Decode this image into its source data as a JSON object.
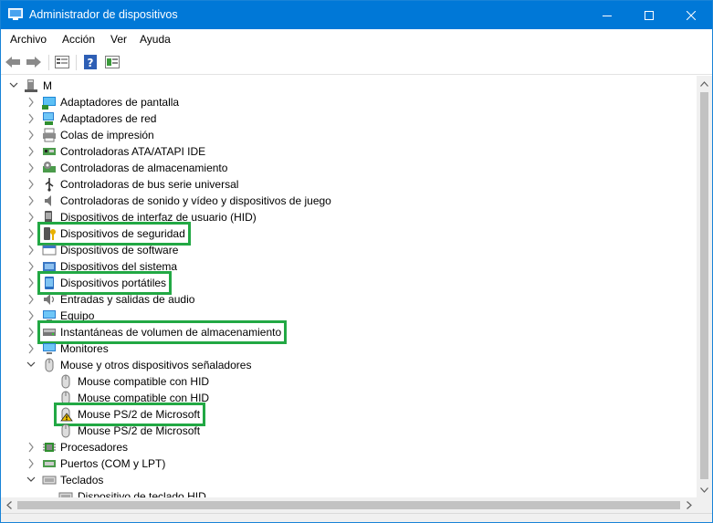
{
  "window": {
    "title": "Administrador de dispositivos",
    "colors": {
      "titlebar": "#0078d7",
      "highlight": "#22a844"
    }
  },
  "menu": [
    "Archivo",
    "Acción",
    "Ver",
    "Ayuda"
  ],
  "toolbar": {
    "buttons": [
      "back-arrow-icon",
      "forward-arrow-icon",
      "properties-icon",
      "help-icon",
      "device-view-icon"
    ]
  },
  "tree": {
    "root": {
      "label": "M",
      "icon": "computer-icon",
      "expanded": true
    },
    "items": [
      {
        "label": "Adaptadores de pantalla",
        "icon": "display-adapter-icon",
        "level": 1,
        "state": "collapsed",
        "highlighted": false
      },
      {
        "label": "Adaptadores de red",
        "icon": "network-adapter-icon",
        "level": 1,
        "state": "collapsed",
        "highlighted": false
      },
      {
        "label": "Colas de impresión",
        "icon": "print-queue-icon",
        "level": 1,
        "state": "collapsed",
        "highlighted": false
      },
      {
        "label": "Controladoras ATA/ATAPI IDE",
        "icon": "ide-controller-icon",
        "level": 1,
        "state": "collapsed",
        "highlighted": false
      },
      {
        "label": "Controladoras de almacenamiento",
        "icon": "storage-controller-icon",
        "level": 1,
        "state": "collapsed",
        "highlighted": false
      },
      {
        "label": "Controladoras de bus serie universal",
        "icon": "usb-icon",
        "level": 1,
        "state": "collapsed",
        "highlighted": false
      },
      {
        "label": "Controladoras de sonido y vídeo y dispositivos de juego",
        "icon": "sound-icon",
        "level": 1,
        "state": "collapsed",
        "highlighted": false
      },
      {
        "label": "Dispositivos de interfaz de usuario (HID)",
        "icon": "hid-icon",
        "level": 1,
        "state": "collapsed",
        "highlighted": false
      },
      {
        "label": "Dispositivos de seguridad",
        "icon": "security-device-icon",
        "level": 1,
        "state": "collapsed",
        "highlighted": true
      },
      {
        "label": "Dispositivos de software",
        "icon": "software-device-icon",
        "level": 1,
        "state": "collapsed",
        "highlighted": false
      },
      {
        "label": "Dispositivos del sistema",
        "icon": "system-device-icon",
        "level": 1,
        "state": "collapsed",
        "highlighted": false
      },
      {
        "label": "Dispositivos portátiles",
        "icon": "portable-device-icon",
        "level": 1,
        "state": "collapsed",
        "highlighted": true
      },
      {
        "label": "Entradas y salidas de audio",
        "icon": "audio-io-icon",
        "level": 1,
        "state": "collapsed",
        "highlighted": false
      },
      {
        "label": "Equipo",
        "icon": "computer-icon",
        "level": 1,
        "state": "collapsed",
        "highlighted": false
      },
      {
        "label": "Instantáneas de volumen de almacenamiento",
        "icon": "volume-shadow-icon",
        "level": 1,
        "state": "collapsed",
        "highlighted": true
      },
      {
        "label": "Monitores",
        "icon": "monitor-icon",
        "level": 1,
        "state": "collapsed",
        "highlighted": false
      },
      {
        "label": "Mouse y otros dispositivos señaladores",
        "icon": "mouse-icon",
        "level": 1,
        "state": "expanded",
        "highlighted": false
      },
      {
        "label": "Mouse compatible con HID",
        "icon": "mouse-icon",
        "level": 2,
        "state": "leaf",
        "highlighted": false
      },
      {
        "label": "Mouse compatible con HID",
        "icon": "mouse-icon",
        "level": 2,
        "state": "leaf",
        "highlighted": false
      },
      {
        "label": "Mouse PS/2 de Microsoft",
        "icon": "mouse-warning-icon",
        "level": 2,
        "state": "leaf",
        "highlighted": true
      },
      {
        "label": "Mouse PS/2 de Microsoft",
        "icon": "mouse-icon",
        "level": 2,
        "state": "leaf",
        "highlighted": false
      },
      {
        "label": "Procesadores",
        "icon": "processor-icon",
        "level": 1,
        "state": "collapsed",
        "highlighted": false
      },
      {
        "label": "Puertos (COM y LPT)",
        "icon": "port-icon",
        "level": 1,
        "state": "collapsed",
        "highlighted": false
      },
      {
        "label": "Teclados",
        "icon": "keyboard-icon",
        "level": 1,
        "state": "expanded",
        "highlighted": false
      },
      {
        "label": "Dispositivo de teclado HID",
        "icon": "keyboard-icon",
        "level": 2,
        "state": "leaf",
        "highlighted": false
      }
    ]
  }
}
